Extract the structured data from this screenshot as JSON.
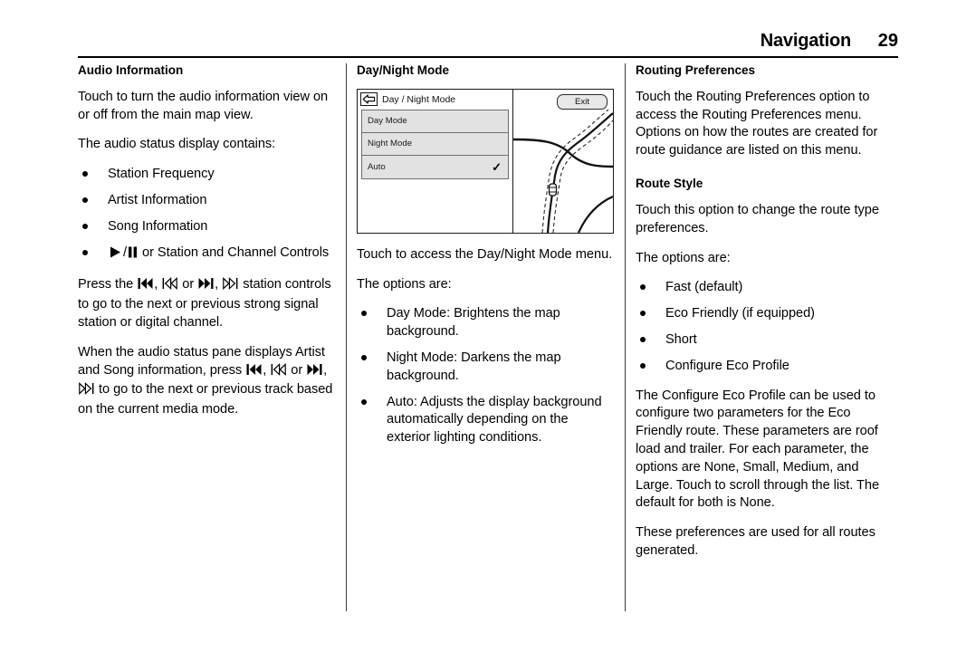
{
  "header": {
    "title": "Navigation",
    "page_number": "29"
  },
  "columns": [
    {
      "name": "column-one",
      "blocks": [
        {
          "type": "heading",
          "text": "Audio Information"
        },
        {
          "type": "para",
          "text": "Touch to turn the audio information view on or off from the main map view."
        },
        {
          "type": "para",
          "text": "The audio status display contains:"
        },
        {
          "type": "bullet",
          "text": "Station Frequency"
        },
        {
          "type": "bullet",
          "text": "Artist Information"
        },
        {
          "type": "bullet",
          "text": "Song Information"
        },
        {
          "type": "bullet-icons",
          "text": "or Station and Channel Controls"
        },
        {
          "type": "para",
          "text": "Press the , or , station controls to go to the next or previous strong signal station or digital channel."
        },
        {
          "type": "para",
          "text": "When the audio status pane displays Artist and Song information, press , or , to go to the next or previous track based on the current media mode."
        }
      ],
      "text": {
        "heading_audio_information": "Audio Information",
        "para_touch_to_turn": "Touch to turn the audio information view on or off from the main map view.",
        "para_audio_status_contains": "The audio status display contains:",
        "bullet_station_frequency": "Station Frequency",
        "bullet_artist_information": "Artist Information",
        "bullet_song_information": "Song Information",
        "bullet_play_pause_prefix": "or Station and Channel Controls",
        "para_press_the_prefix": "Press the",
        "para_press_the_mid": "or",
        "para_press_the_suffix": "station controls to go to the next or previous strong signal station or digital channel.",
        "para_when_audio_prefix": "When the audio status pane displays Artist and Song information, press",
        "para_when_audio_mid": "or",
        "para_when_audio_suffix": "to go to the next or previous track based on the current media mode.",
        "comma": ","
      }
    },
    {
      "name": "column-two",
      "device": {
        "title": "Day / Night Mode",
        "back_icon": "back-arrow-icon",
        "exit_label": "Exit",
        "menu_items": [
          {
            "label": "Day Mode",
            "checked": false
          },
          {
            "label": "Night Mode",
            "checked": false
          },
          {
            "label": "Auto",
            "checked": true
          }
        ],
        "check_glyph": "✓"
      },
      "text": {
        "heading_day_night_mode": "Day/Night Mode",
        "para_touch_to_access": "Touch to access the Day/Night Mode menu.",
        "para_the_options_are": "The options are:",
        "bullet_day_mode": "Day Mode: Brightens the map background.",
        "bullet_night_mode": "Night Mode: Darkens the map background.",
        "bullet_auto": "Auto: Adjusts the display background automatically depending on the exterior lighting conditions."
      }
    },
    {
      "name": "column-three",
      "text": {
        "heading_routing_preferences": "Routing Preferences",
        "para_touch_routing_prefs": "Touch the Routing Preferences option to access the Routing Preferences menu. Options on how the routes are created for route guidance are listed on this menu.",
        "heading_route_style": "Route Style",
        "para_touch_this_option": "Touch this option to change the route type preferences.",
        "para_the_options_are": "The options are:",
        "bullet_fast": "Fast (default)",
        "bullet_eco_friendly": "Eco Friendly (if equipped)",
        "bullet_short": "Short",
        "bullet_configure_eco_profile": "Configure Eco Profile",
        "para_configure_eco_profile": "The Configure Eco Profile can be used to configure two parameters for the Eco Friendly route. These parameters are roof load and trailer. For each parameter, the options are None, Small, Medium, and Large. Touch to scroll through the list. The default for both is None.",
        "para_these_preferences": "These preferences are used for all routes generated."
      }
    }
  ],
  "colors": {
    "text": "#000000",
    "rule": "#000000",
    "divider": "#3a3a3a",
    "menu_row_fill": "#e2e2e2",
    "menu_border": "#6d6d6d",
    "button_fill": "#e8e8e8"
  }
}
